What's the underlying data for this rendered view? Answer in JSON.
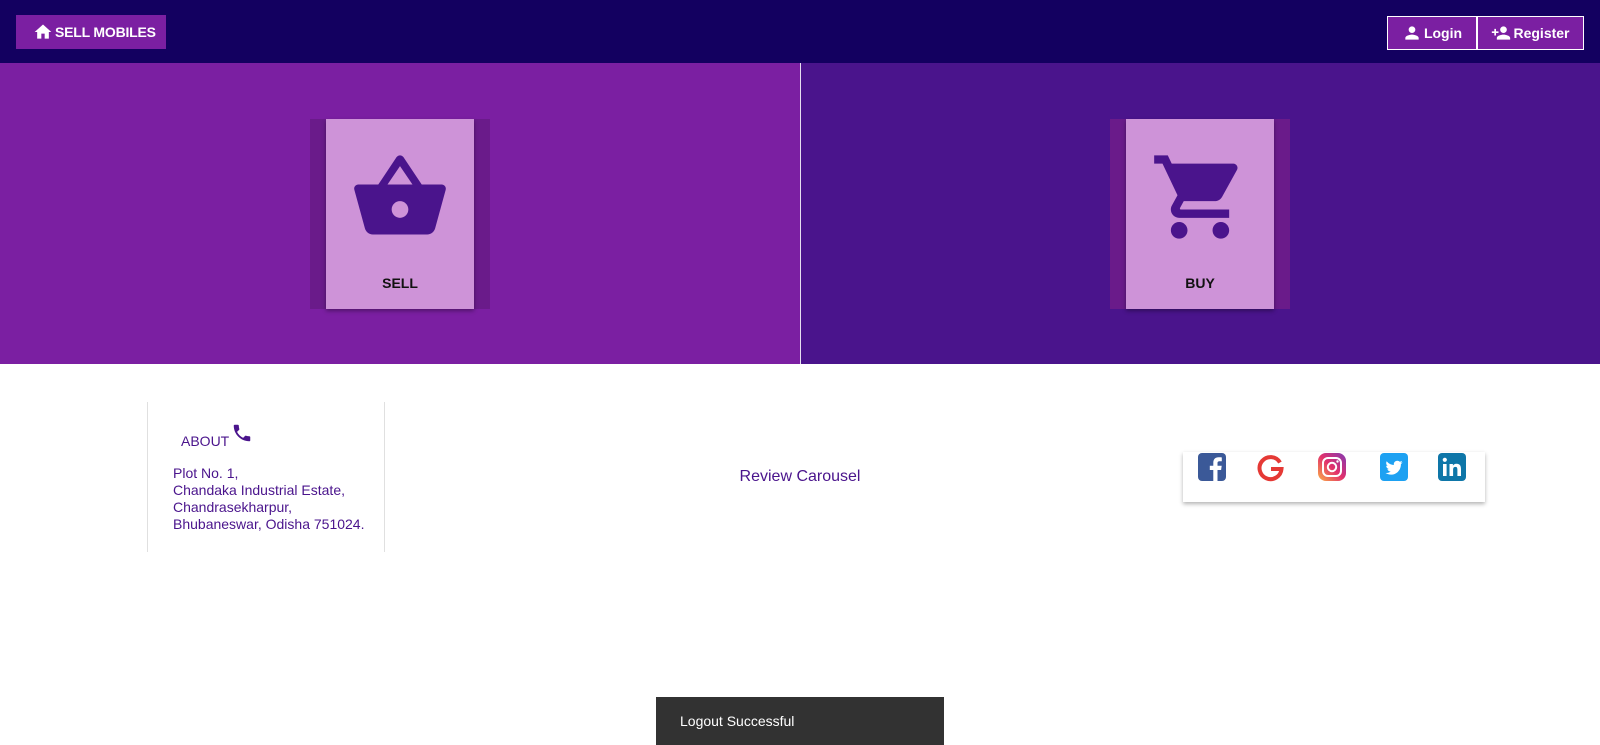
{
  "header": {
    "brand_label": "SELL MOBILES",
    "login_label": "Login",
    "register_label": "Register"
  },
  "hero": {
    "sell_label": "SELL",
    "buy_label": "BUY"
  },
  "about": {
    "title": "ABOUT",
    "address_lines": [
      "Plot No. 1,",
      "Chandaka Industrial Estate,",
      "Chandrasekharpur,",
      "Bhubaneswar, Odisha 751024."
    ]
  },
  "review_label": "Review Carousel",
  "social_icons": [
    "facebook-icon",
    "google-icon",
    "instagram-icon",
    "twitter-icon",
    "linkedin-icon"
  ],
  "snackbar_message": "Logout Successful",
  "colors": {
    "topbar": "#130060",
    "accent": "#7b1fa2",
    "hero_right": "#4a148c",
    "card": "#ce93d8",
    "text_purple": "#4a148c"
  }
}
